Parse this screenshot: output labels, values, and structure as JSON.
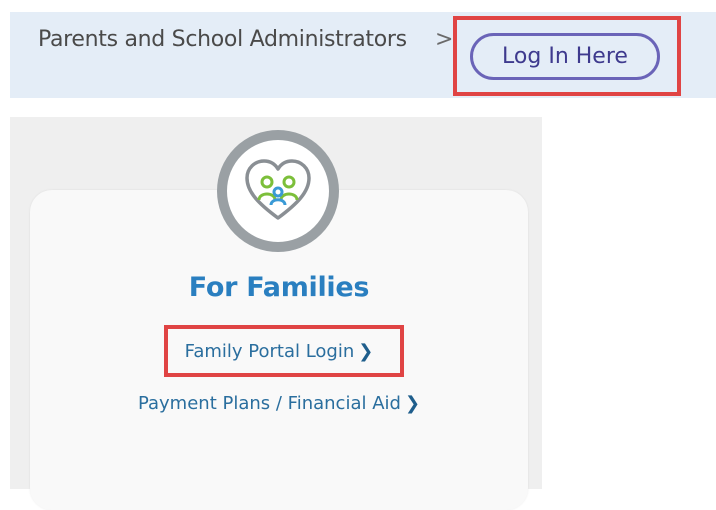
{
  "banner": {
    "breadcrumb_text": "Parents and School Administrators",
    "separator": ">",
    "login_button": "Log In Here",
    "background_color": "#e4edf7"
  },
  "card": {
    "icon": "family-heart-icon",
    "title": "For Families",
    "links": [
      {
        "label": "Family Portal Login",
        "chevron": "❯"
      },
      {
        "label": "Payment Plans / Financial Aid",
        "chevron": "❯"
      }
    ]
  },
  "annotations": {
    "highlight_color": "#e04444"
  },
  "colors": {
    "accent": "#2a7fc0",
    "link": "#2a6e9e",
    "pill_border": "#6a64b8"
  }
}
